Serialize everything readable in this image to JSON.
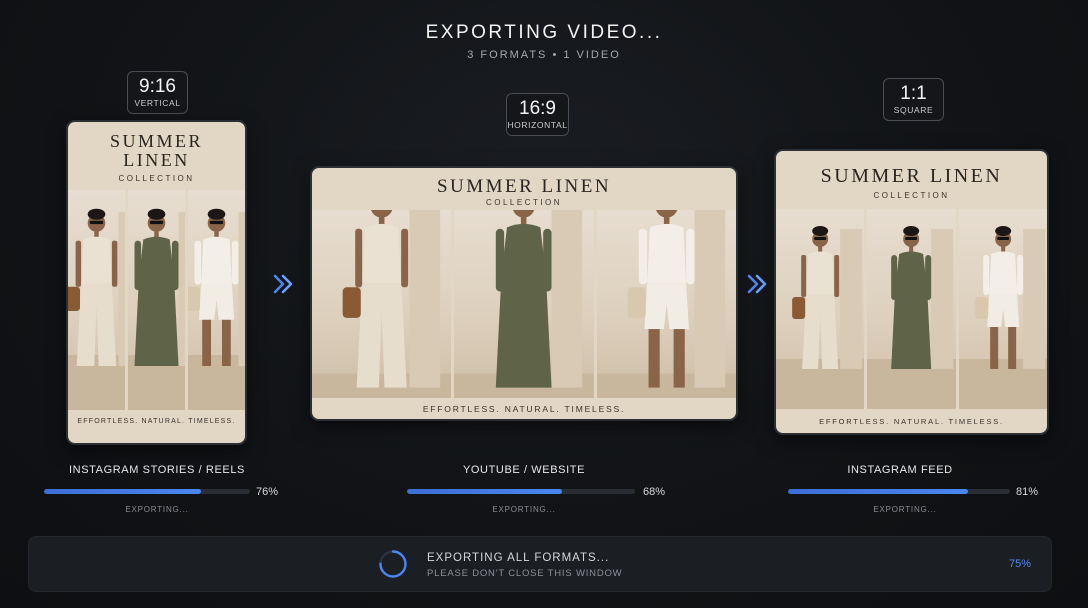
{
  "header": {
    "title": "EXPORTING VIDEO...",
    "subtitle": "3 FORMATS • 1 VIDEO"
  },
  "brand": {
    "name": "SUMMER LINEN",
    "name_line1": "SUMMER",
    "name_line2": "LINEN",
    "collection": "COLLECTION",
    "tagline": "EFFORTLESS. NATURAL. TIMELESS."
  },
  "formats": [
    {
      "ratio": "9:16",
      "orientation": "VERTICAL",
      "label": "INSTAGRAM STORIES / REELS",
      "progress": 76,
      "progress_text": "76%",
      "status": "EXPORTING..."
    },
    {
      "ratio": "16:9",
      "orientation": "HORIZONTAL",
      "label": "YOUTUBE / WEBSITE",
      "progress": 68,
      "progress_text": "68%",
      "status": "EXPORTING..."
    },
    {
      "ratio": "1:1",
      "orientation": "SQUARE",
      "label": "INSTAGRAM FEED",
      "progress": 81,
      "progress_text": "81%",
      "status": "EXPORTING..."
    }
  ],
  "footer": {
    "title": "EXPORTING ALL FORMATS...",
    "subtitle": "PLEASE DON'T CLOSE THIS WINDOW",
    "overall_progress": 75,
    "overall_text": "75%"
  },
  "colors": {
    "accent": "#4b86f0",
    "background": "#101215",
    "preview_bg": "#e2d6c4"
  },
  "icons": [
    "double-chevron-right-icon",
    "spinner-icon"
  ]
}
